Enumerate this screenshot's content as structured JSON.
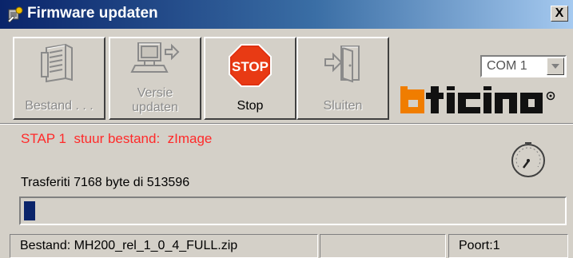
{
  "window": {
    "title": "Firmware updaten",
    "close_label": "X"
  },
  "toolbar": {
    "buttons": [
      {
        "label": "Bestand . . .",
        "icon": "file-cabinet-icon",
        "enabled": false
      },
      {
        "label_line1": "Versie",
        "label_line2": "updaten",
        "icon": "computer-upload-icon",
        "enabled": false
      },
      {
        "label": "Stop",
        "icon": "stop-sign-icon",
        "enabled": true
      },
      {
        "label": "Sluiten",
        "icon": "exit-door-icon",
        "enabled": false
      }
    ]
  },
  "port_select": {
    "value": "COM 1"
  },
  "brand": {
    "accent": "#f07d00"
  },
  "status": {
    "stap": "STAP 1  stuur bestand:  zImage",
    "transfer": "Trasferiti 7168 byte di 513596",
    "progress_fraction": 0.014
  },
  "statusbar": {
    "file": "Bestand: MH200_rel_1_0_4_FULL.zip",
    "middle": "",
    "port": "Poort:1"
  },
  "colors": {
    "status_text": "#ff2a2a",
    "progress_fill": "#0a246a"
  }
}
